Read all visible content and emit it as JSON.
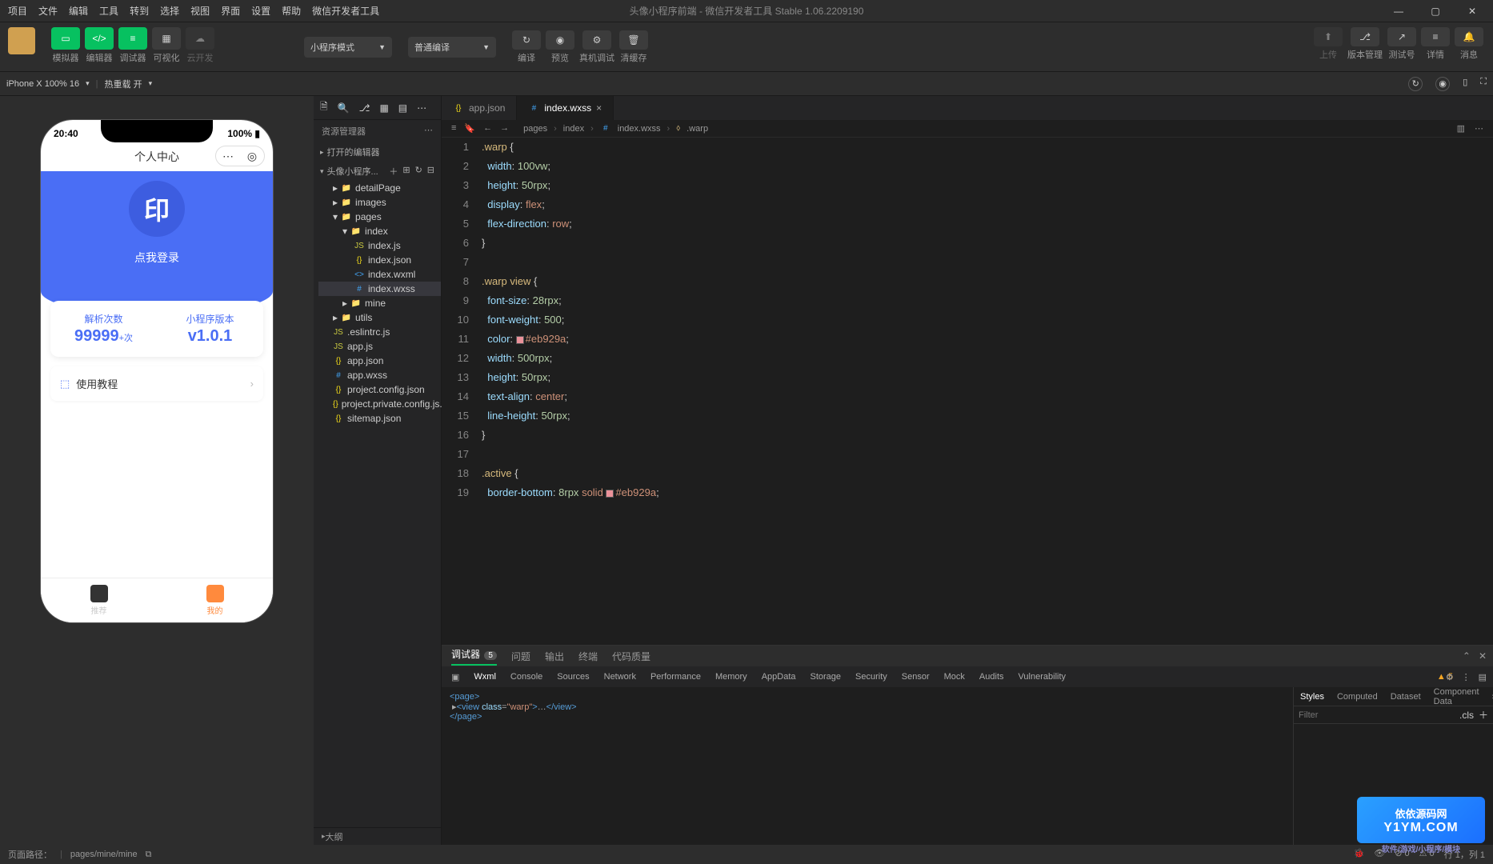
{
  "menubar": {
    "items": [
      "项目",
      "文件",
      "编辑",
      "工具",
      "转到",
      "选择",
      "视图",
      "界面",
      "设置",
      "帮助",
      "微信开发者工具"
    ],
    "title_prefix": "头像小程序前端",
    "title_suffix": " - 微信开发者工具 Stable 1.06.2209190"
  },
  "toolbar": {
    "groups_left": [
      "模拟器",
      "编辑器",
      "调试器",
      "可视化",
      "云开发"
    ],
    "select_mode": "小程序模式",
    "select_compile": "普通编译",
    "center_labels": [
      "编译",
      "预览",
      "真机调试",
      "清缓存"
    ],
    "right_labels": [
      "上传",
      "版本管理",
      "测试号",
      "详情",
      "消息"
    ]
  },
  "sim": {
    "device": "iPhone X 100% 16",
    "hot": "热重载 开",
    "phone": {
      "time": "20:40",
      "battery": "100%",
      "title": "个人中心",
      "login": "点我登录",
      "logo": "印",
      "stat1_label": "解析次数",
      "stat1_value": "99999",
      "stat1_unit": "+次",
      "stat2_label": "小程序版本",
      "stat2_value": "v1.0.1",
      "row1": "使用教程",
      "tab1": "推荐",
      "tab2": "我的"
    }
  },
  "explorer": {
    "title": "资源管理器",
    "open_editors": "打开的编辑器",
    "project": "头像小程序...",
    "tree": [
      {
        "d": 1,
        "t": "folder",
        "n": "detailPage",
        "c": true
      },
      {
        "d": 1,
        "t": "folder",
        "n": "images",
        "c": true,
        "ico": "img"
      },
      {
        "d": 1,
        "t": "folder",
        "n": "pages",
        "c": false,
        "open": true
      },
      {
        "d": 2,
        "t": "folder",
        "n": "index",
        "c": false,
        "open": true
      },
      {
        "d": 3,
        "t": "js",
        "n": "index.js"
      },
      {
        "d": 3,
        "t": "json",
        "n": "index.json"
      },
      {
        "d": 3,
        "t": "wxml",
        "n": "index.wxml"
      },
      {
        "d": 3,
        "t": "wxss",
        "n": "index.wxss",
        "sel": true
      },
      {
        "d": 2,
        "t": "folder",
        "n": "mine",
        "c": true
      },
      {
        "d": 1,
        "t": "folder",
        "n": "utils",
        "c": true,
        "ico": "js"
      },
      {
        "d": 1,
        "t": "js",
        "n": ".eslintrc.js",
        "dot": true
      },
      {
        "d": 1,
        "t": "js",
        "n": "app.js"
      },
      {
        "d": 1,
        "t": "json",
        "n": "app.json"
      },
      {
        "d": 1,
        "t": "wxss",
        "n": "app.wxss"
      },
      {
        "d": 1,
        "t": "json",
        "n": "project.config.json"
      },
      {
        "d": 1,
        "t": "json",
        "n": "project.private.config.js..."
      },
      {
        "d": 1,
        "t": "json",
        "n": "sitemap.json"
      }
    ],
    "outline": "大纲"
  },
  "tabs": [
    {
      "n": "app.json",
      "t": "json"
    },
    {
      "n": "index.wxss",
      "t": "wxss",
      "active": true
    }
  ],
  "breadcrumb": [
    "pages",
    "index",
    "index.wxss",
    ".warp"
  ],
  "code_lines": [
    {
      "n": 1,
      "html": "<span class='tok-sel'>.warp</span> <span class='tok-brace'>{</span>"
    },
    {
      "n": 2,
      "html": "  <span class='tok-prop'>width</span><span class='tok-punc'>:</span> <span class='tok-num'>100vw</span><span class='tok-punc'>;</span>"
    },
    {
      "n": 3,
      "html": "  <span class='tok-prop'>height</span><span class='tok-punc'>:</span> <span class='tok-num'>50rpx</span><span class='tok-punc'>;</span>"
    },
    {
      "n": 4,
      "html": "  <span class='tok-prop'>display</span><span class='tok-punc'>:</span> <span class='tok-val'>flex</span><span class='tok-punc'>;</span>"
    },
    {
      "n": 5,
      "html": "  <span class='tok-prop'>flex-direction</span><span class='tok-punc'>:</span> <span class='tok-val'>row</span><span class='tok-punc'>;</span>"
    },
    {
      "n": 6,
      "html": "<span class='tok-brace'>}</span>"
    },
    {
      "n": 7,
      "html": ""
    },
    {
      "n": 8,
      "html": "<span class='tok-sel'>.warp view</span> <span class='tok-brace'>{</span>"
    },
    {
      "n": 9,
      "html": "  <span class='tok-prop'>font-size</span><span class='tok-punc'>:</span> <span class='tok-num'>28rpx</span><span class='tok-punc'>;</span>"
    },
    {
      "n": 10,
      "html": "  <span class='tok-prop'>font-weight</span><span class='tok-punc'>:</span> <span class='tok-num'>500</span><span class='tok-punc'>;</span>"
    },
    {
      "n": 11,
      "html": "  <span class='tok-prop'>color</span><span class='tok-punc'>:</span> <span class='swatch'></span><span class='tok-val'>#eb929a</span><span class='tok-punc'>;</span>"
    },
    {
      "n": 12,
      "html": "  <span class='tok-prop'>width</span><span class='tok-punc'>:</span> <span class='tok-num'>500rpx</span><span class='tok-punc'>;</span>"
    },
    {
      "n": 13,
      "html": "  <span class='tok-prop'>height</span><span class='tok-punc'>:</span> <span class='tok-num'>50rpx</span><span class='tok-punc'>;</span>"
    },
    {
      "n": 14,
      "html": "  <span class='tok-prop'>text-align</span><span class='tok-punc'>:</span> <span class='tok-val'>center</span><span class='tok-punc'>;</span>"
    },
    {
      "n": 15,
      "html": "  <span class='tok-prop'>line-height</span><span class='tok-punc'>:</span> <span class='tok-num'>50rpx</span><span class='tok-punc'>;</span>"
    },
    {
      "n": 16,
      "html": "<span class='tok-brace'>}</span>"
    },
    {
      "n": 17,
      "html": ""
    },
    {
      "n": 18,
      "html": "<span class='tok-sel'>.active</span> <span class='tok-brace'>{</span>"
    },
    {
      "n": 19,
      "html": "  <span class='tok-prop'>border-bottom</span><span class='tok-punc'>:</span> <span class='tok-num'>8rpx</span> <span class='tok-val'>solid</span> <span class='swatch'></span><span class='tok-val'>#eb929a</span><span class='tok-punc'>;</span>"
    }
  ],
  "devtools": {
    "tabs1": [
      "调试器",
      "问题",
      "输出",
      "终端",
      "代码质量"
    ],
    "badge": "5",
    "tabs2": [
      "Wxml",
      "Console",
      "Sources",
      "Network",
      "Performance",
      "Memory",
      "AppData",
      "Storage",
      "Security",
      "Sensor",
      "Mock",
      "Audits",
      "Vulnerability"
    ],
    "warn": "5",
    "dom_lines": [
      "<page>",
      "  ▸<view class=\"warp\">…</view>",
      "</page>"
    ],
    "side_tabs": [
      "Styles",
      "Computed",
      "Dataset",
      "Component Data"
    ],
    "filter_placeholder": "Filter",
    "cls": ".cls"
  },
  "statusbar": {
    "path_label": "页面路径：",
    "path": "pages/mine/mine",
    "r1": "0",
    "r2": "0",
    "caret": "行 1，列 1"
  },
  "watermark": {
    "l1": "依依源码网",
    "l2": "Y1YM.COM",
    "tag": "软件/游戏/小程序/模块"
  }
}
